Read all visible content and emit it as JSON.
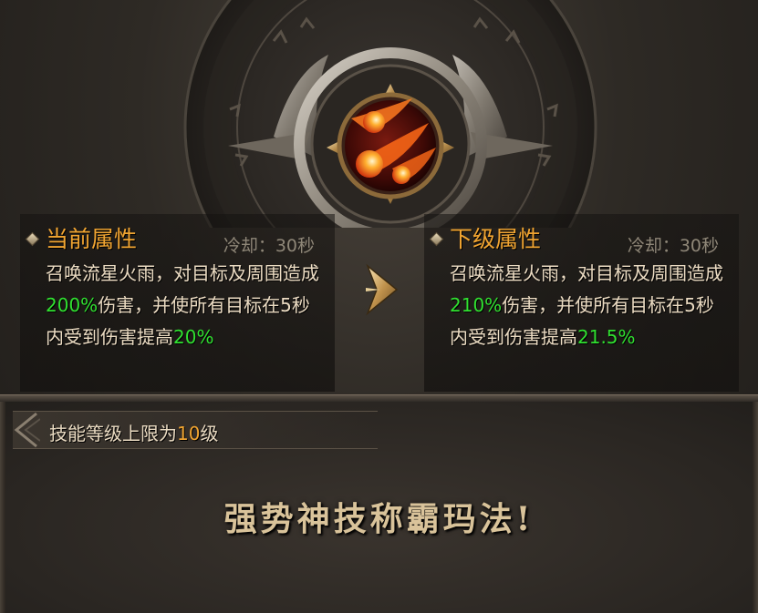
{
  "skill": {
    "icon": "meteor-rain-icon"
  },
  "current": {
    "title": "当前属性",
    "cooldown": "冷却：30秒",
    "desc_before": "召唤流星火雨，对目标及周围造成",
    "damage": "200%",
    "desc_middle": "伤害，并使所有目标在5秒内受到伤害提高",
    "bonus": "20%"
  },
  "next": {
    "title": "下级属性",
    "cooldown": "冷却：30秒",
    "desc_before": "召唤流星火雨，对目标及周围造成",
    "damage": "210%",
    "desc_middle": "伤害，并使所有目标在5秒内受到伤害提高",
    "bonus": "21.5%"
  },
  "level_limit": {
    "prefix": "技能等级上限为",
    "value": "10",
    "suffix": "级"
  },
  "slogan": "强势神技称霸玛法!",
  "colors": {
    "title": "#f0a431",
    "highlight": "#30e030",
    "text": "#ecdcc3",
    "cooldown": "#8f8778"
  }
}
